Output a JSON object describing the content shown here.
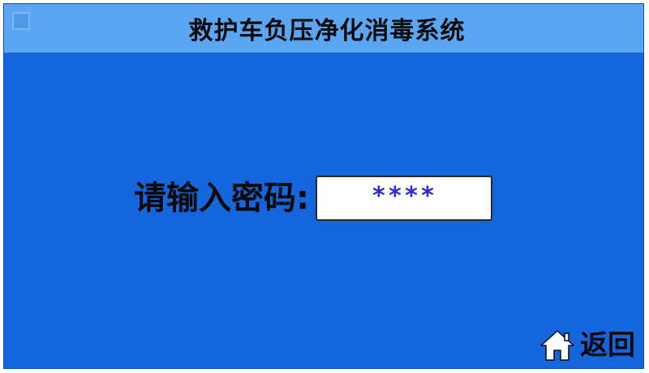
{
  "title_bar": {
    "title": "救护车负压净化消毒系统"
  },
  "login": {
    "label": "请输入密码:",
    "password_value": "****"
  },
  "footer": {
    "back_label": "返回",
    "back_icon": "home-icon"
  },
  "colors": {
    "background": "#1565dc",
    "title_bar": "#5aa6f2",
    "password_text": "#2b2bd8"
  }
}
